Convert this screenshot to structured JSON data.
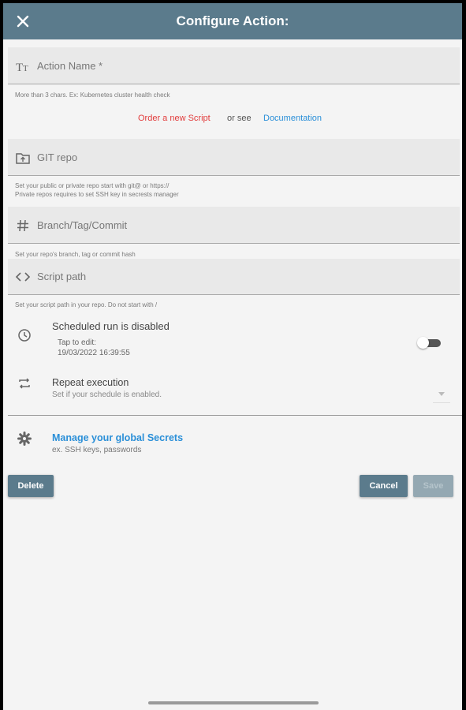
{
  "header": {
    "title": "Configure Action:",
    "close_icon": "close-icon"
  },
  "fields": {
    "action_name": {
      "label": "Action Name *",
      "hint": "More than 3 chars. Ex: Kubernetes cluster health check",
      "icon": "text-format-icon"
    },
    "git_repo": {
      "label": "GIT repo",
      "hint_line1": "Set your public or private repo start with git@ or https://",
      "hint_line2": "Private repos requires to set SSH key in secrests manager",
      "icon": "folder-upload-icon"
    },
    "branch": {
      "label": "Branch/Tag/Commit",
      "hint": "Set your repo's  branch, tag or commit hash",
      "icon": "hash-icon"
    },
    "script_path": {
      "label": "Script path",
      "hint": "Set your script path in your repo. Do not start with /",
      "icon": "code-icon"
    }
  },
  "links": {
    "order": "Order a new Script",
    "or_see": "or see",
    "documentation": "Documentation"
  },
  "schedule": {
    "title": "Scheduled run is disabled",
    "tap_to_edit": "Tap to edit:",
    "datetime": "19/03/2022 16:39:55",
    "enabled": false
  },
  "repeat": {
    "title": "Repeat execution",
    "subtitle": "Set if your schedule is enabled."
  },
  "secrets": {
    "title": "Manage your global Secrets",
    "subtitle": "ex. SSH keys, passwords"
  },
  "buttons": {
    "delete": "Delete",
    "cancel": "Cancel",
    "save": "Save"
  },
  "colors": {
    "header": "#5b7b8c",
    "link_red": "#e23b3b",
    "link_blue": "#2a8fd8",
    "background": "#f4f4f4"
  }
}
